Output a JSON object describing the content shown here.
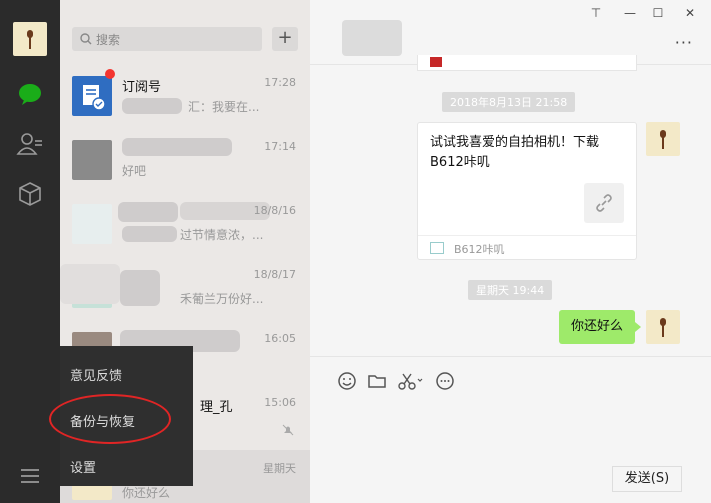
{
  "search": {
    "placeholder": "搜索"
  },
  "chats": [
    {
      "name": "订阅号",
      "time": "17:28",
      "preview": "汇：我要在..."
    },
    {
      "name": "",
      "time": "17:14",
      "preview": "好吧"
    },
    {
      "name": "",
      "time": "18/8/16",
      "preview": "过节情意浓，..."
    },
    {
      "name": "",
      "time": "18/8/17",
      "preview": "禾葡兰万份好..."
    },
    {
      "name": "",
      "time": "16:05",
      "preview": ""
    },
    {
      "name": "理_孔",
      "time": "15:06",
      "preview": ""
    },
    {
      "name": "",
      "time": "星期天",
      "preview": "你还好么"
    }
  ],
  "menu": {
    "feedback": "意见反馈",
    "backup": "备份与恢复",
    "settings": "设置"
  },
  "window": {
    "pin": "⊤",
    "minimize": "—",
    "maximize": "☐",
    "close": "✕"
  },
  "messages": {
    "ts1": "2018年8月13日 21:58",
    "card_title": "试试我喜爱的自拍相机！下载B612咔叽",
    "card_source": "B612咔叽",
    "ts2": "星期天 19:44",
    "sent": "你还好么"
  },
  "send_button": "发送(S)"
}
